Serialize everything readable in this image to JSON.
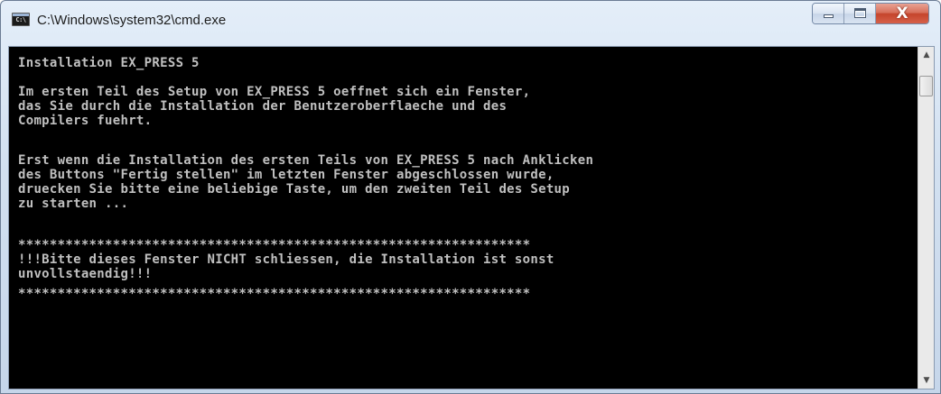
{
  "window": {
    "title": "C:\\Windows\\system32\\cmd.exe",
    "icon": "cmd-icon",
    "icon_text": "C:\\",
    "buttons": {
      "minimize": "minimize-icon",
      "maximize": "maximize-icon",
      "close": "close-icon",
      "close_glyph": "X"
    }
  },
  "console": {
    "background": "#000000",
    "foreground": "#c0c0c0",
    "lines": [
      "Installation EX_PRESS 5",
      "",
      "Im ersten Teil des Setup von EX_PRESS 5 oeffnet sich ein Fenster,",
      "das Sie durch die Installation der Benutzeroberflaeche und des",
      "Compilers fuehrt.",
      "",
      "Erst wenn die Installation des ersten Teils von EX_PRESS 5 nach Anklicken",
      "des Buttons \"Fertig stellen\" im letzten Fenster abgeschlossen wurde,",
      "druecken Sie bitte eine beliebige Taste, um den zweiten Teil des Setup",
      "zu starten ...",
      "",
      "*****************************************************************",
      "!!!Bitte dieses Fenster NICHT schliessen, die Installation ist sonst",
      "unvollstaendig!!!",
      "*****************************************************************"
    ]
  },
  "scrollbar": {
    "up_arrow": "▲",
    "down_arrow": "▼"
  }
}
